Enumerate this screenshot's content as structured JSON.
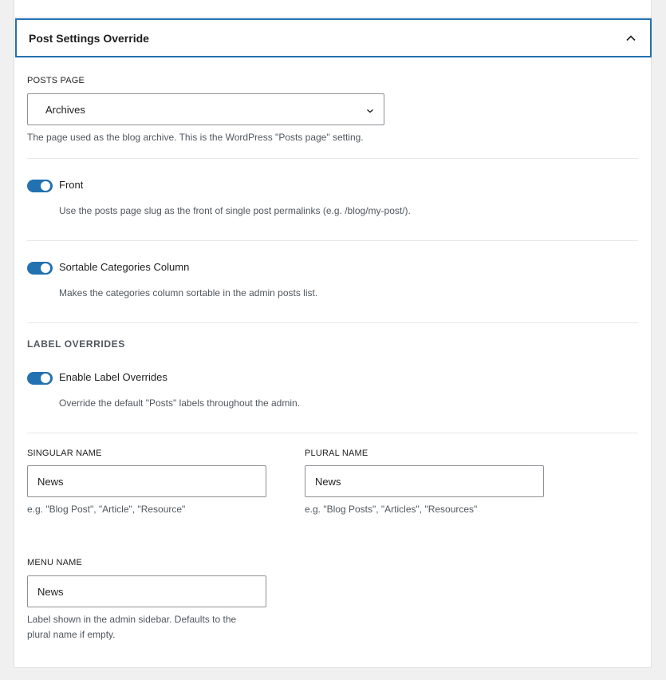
{
  "panel": {
    "title": "Post Settings Override"
  },
  "posts_page": {
    "label": "POSTS PAGE",
    "selected": "Archives",
    "help": "The page used as the blog archive. This is the WordPress \"Posts page\" setting."
  },
  "front": {
    "label": "Front",
    "enabled": true,
    "help": "Use the posts page slug as the front of single post permalinks (e.g. /blog/my-post/)."
  },
  "sortable": {
    "label": "Sortable Categories Column",
    "enabled": true,
    "help": "Makes the categories column sortable in the admin posts list."
  },
  "label_overrides": {
    "section_title": "LABEL OVERRIDES",
    "toggle_label": "Enable Label Overrides",
    "enabled": true,
    "help": "Override the default \"Posts\" labels throughout the admin."
  },
  "singular": {
    "label": "SINGULAR NAME",
    "value": "News",
    "help": "e.g. \"Blog Post\", \"Article\", \"Resource\""
  },
  "plural": {
    "label": "PLURAL NAME",
    "value": "News",
    "help": "e.g. \"Blog Posts\", \"Articles\", \"Resources\""
  },
  "menu": {
    "label": "MENU NAME",
    "value": "News",
    "help_line1": "Label shown in the admin sidebar. Defaults to the",
    "help_line2": "plural name if empty."
  },
  "colors": {
    "accent": "#2271b1",
    "help_text": "#50575e",
    "border": "#8c8f94"
  },
  "icons": {
    "header": "chevron-up-icon",
    "select": "chevron-down-icon"
  }
}
